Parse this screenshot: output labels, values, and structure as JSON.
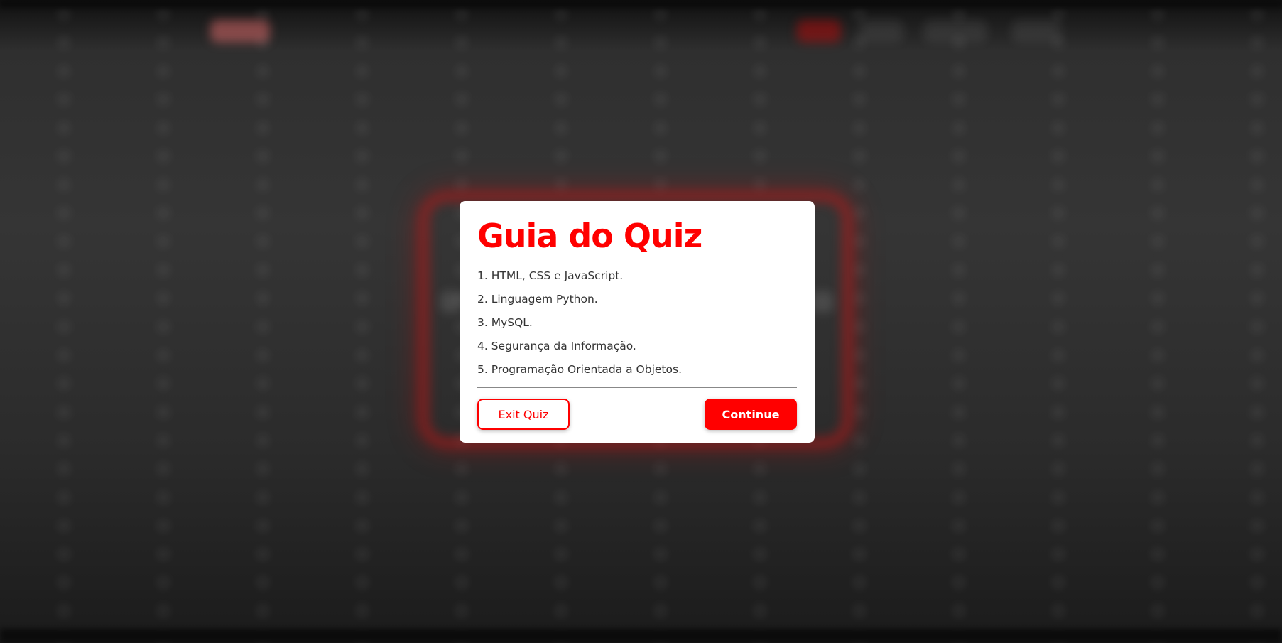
{
  "modal": {
    "title": "Guia do Quiz",
    "rules": [
      "1. HTML, CSS e JavaScript.",
      "2. Linguagem Python.",
      "3. MySQL.",
      "4. Segurança da Informação.",
      "5. Programação Orientada a Objetos."
    ],
    "exit_label": "Exit Quiz",
    "continue_label": "Continue"
  },
  "colors": {
    "accent": "#ff0000",
    "modal_background": "#ffffff",
    "text": "#333333",
    "backdrop": "#2f2f2f"
  }
}
